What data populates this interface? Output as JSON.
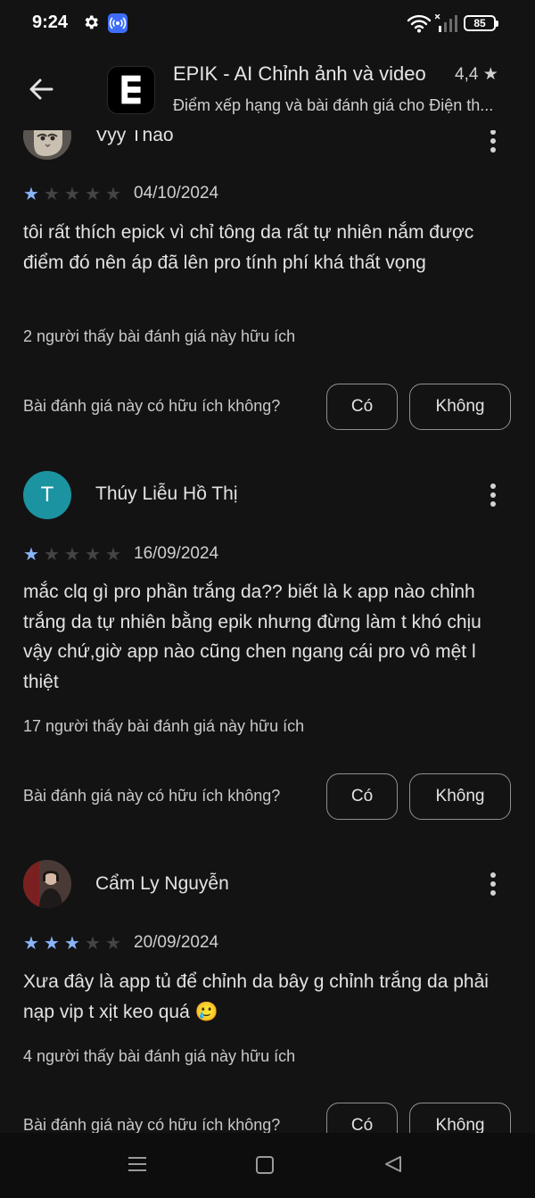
{
  "status_bar": {
    "time": "9:24",
    "battery": "85",
    "icons": [
      "gear-icon",
      "radio-signal-icon",
      "wifi-icon",
      "cell-signal-icon",
      "battery-icon"
    ]
  },
  "header": {
    "back_icon": "arrow-left-icon",
    "app_name": "EPIK - AI Chỉnh ảnh và video",
    "rating": "4,4 ★",
    "subtitle": "Điểm xếp hạng và bài đánh giá cho Điện th..."
  },
  "helpful_question": "Bài đánh giá này có hữu ích không?",
  "yes_label": "Có",
  "no_label": "Không",
  "reviews": [
    {
      "name": "Vyy Thảo",
      "avatar": "cat-photo",
      "stars": 1,
      "date": "04/10/2024",
      "text": "tôi rất thích epick vì chỉ tông da rất tự nhiên nắm được điểm đó nên áp đã lên pro tính phí khá thất vọng",
      "helpful": "2 người thấy bài đánh giá này hữu ích"
    },
    {
      "name": "Thúy Liễu Hồ Thị",
      "avatar_letter": "T",
      "stars": 1,
      "date": "16/09/2024",
      "text": "mắc clq gì pro phần trắng da?? biết là k app nào chỉnh trắng da tự nhiên bằng epik nhưng đừng làm t khó chịu vậy chứ,giờ app nào cũng chen ngang cái pro vô mệt l thiệt",
      "helpful": "17 người thấy bài đánh giá này hữu ích"
    },
    {
      "name": "Cẩm Ly Nguyễn",
      "avatar": "person-photo",
      "stars": 3,
      "date": "20/09/2024",
      "text": "Xưa đây là app tủ để chỉnh da bây g chỉnh trắng da phải nạp vip t xịt keo quá 🥲",
      "helpful": "4 người thấy bài đánh giá này hữu ích"
    }
  ],
  "nav_bar": {
    "icons": [
      "menu-icon",
      "home-icon",
      "back-triangle-icon"
    ]
  },
  "colors": {
    "background": "#131314",
    "star_on": "#8ab4f8",
    "star_off": "#444446",
    "avatar_teal": "#1c93a0"
  }
}
